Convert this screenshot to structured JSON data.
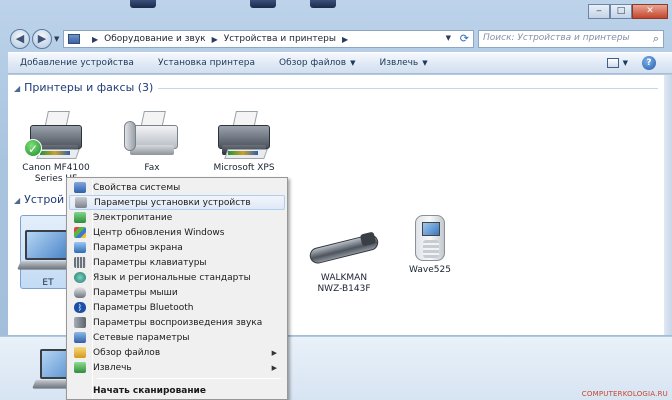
{
  "window": {
    "breadcrumb": [
      "Оборудование и звук",
      "Устройства и принтеры"
    ],
    "search_placeholder": "Поиск: Устройства и принтеры",
    "caption": {
      "minimize": "‒",
      "maximize": "□",
      "close": "✕"
    }
  },
  "toolbar": {
    "items": [
      "Добавление устройства",
      "Установка принтера",
      "Обзор файлов",
      "Извлечь"
    ]
  },
  "groups": {
    "printers": "Принтеры и факсы (3)",
    "devices": "Устрой"
  },
  "printers": [
    {
      "line1": "Canon MF4100",
      "line2": "Series UF",
      "default": true
    },
    {
      "line1": "Fax",
      "line2": ""
    },
    {
      "line1": "Microsoft XPS",
      "line2": ""
    }
  ],
  "devices": [
    {
      "line1": "ET",
      "line2": ""
    },
    {
      "line1": "WALKMAN",
      "line2": "NWZ-B143F"
    },
    {
      "line1": "Wave525",
      "line2": ""
    }
  ],
  "context_menu": {
    "items": [
      {
        "label": "Свойства системы",
        "icon": "system-properties-icon",
        "color": "#4a78c2"
      },
      {
        "label": "Параметры установки устройств",
        "icon": "device-install-icon",
        "color": "#8a8f96",
        "hover": true
      },
      {
        "label": "Электропитание",
        "icon": "power-icon",
        "color": "#2f8c3b"
      },
      {
        "label": "Центр обновления Windows",
        "icon": "windows-update-icon",
        "color": "#d28c1e"
      },
      {
        "label": "Параметры экрана",
        "icon": "display-icon",
        "color": "#3a7cc8"
      },
      {
        "label": "Параметры клавиатуры",
        "icon": "keyboard-icon",
        "color": "#7b8189"
      },
      {
        "label": "Язык и региональные стандарты",
        "icon": "globe-icon",
        "color": "#2b8a7a"
      },
      {
        "label": "Параметры мыши",
        "icon": "mouse-icon",
        "color": "#6d7480"
      },
      {
        "label": "Параметры Bluetooth",
        "icon": "bluetooth-icon",
        "color": "#1c4fa8"
      },
      {
        "label": "Параметры воспроизведения звука",
        "icon": "speaker-icon",
        "color": "#737a84"
      },
      {
        "label": "Сетевые параметры",
        "icon": "network-icon",
        "color": "#3a6fb5"
      },
      {
        "label": "Обзор файлов",
        "icon": "folder-icon",
        "color": "#e0b43c",
        "submenu": true
      },
      {
        "label": "Извлечь",
        "icon": "eject-icon",
        "color": "#3d8f4a",
        "submenu": true
      },
      {
        "label": "Начать сканирование",
        "bold": true
      }
    ]
  },
  "watermark": "COMPUTERKOLOGIA.RU"
}
